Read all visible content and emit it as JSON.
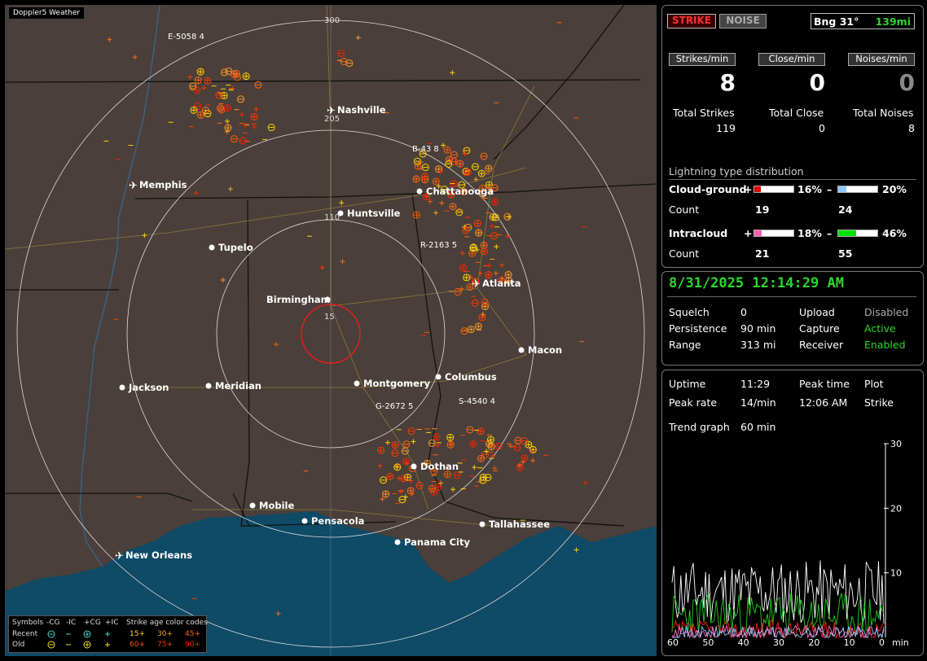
{
  "app_title": "Doppler5 Weather",
  "map": {
    "ring_labels": [
      "300",
      "205",
      "110",
      "15"
    ],
    "cities": [
      {
        "name": "Nashville",
        "kind": "airport"
      },
      {
        "name": "Memphis",
        "kind": "airport"
      },
      {
        "name": "Chattanooga",
        "kind": "city"
      },
      {
        "name": "Huntsville",
        "kind": "city"
      },
      {
        "name": "Tupelo",
        "kind": "city"
      },
      {
        "name": "Birmingham",
        "kind": "city"
      },
      {
        "name": "Atlanta",
        "kind": "airport"
      },
      {
        "name": "Macon",
        "kind": "city"
      },
      {
        "name": "Jackson",
        "kind": "city"
      },
      {
        "name": "Meridian",
        "kind": "city"
      },
      {
        "name": "Montgomery",
        "kind": "city"
      },
      {
        "name": "Columbus",
        "kind": "city"
      },
      {
        "name": "Dothan",
        "kind": "city"
      },
      {
        "name": "Mobile",
        "kind": "city"
      },
      {
        "name": "Pensacola",
        "kind": "city"
      },
      {
        "name": "Tallahassee",
        "kind": "city"
      },
      {
        "name": "Panama City",
        "kind": "city"
      },
      {
        "name": "New Orleans",
        "kind": "airport"
      }
    ],
    "storm_labels": [
      {
        "id": "E-5058",
        "n": "4"
      },
      {
        "id": "B-43",
        "n": "8"
      },
      {
        "id": "R-2163",
        "n": "5"
      },
      {
        "id": "G-2672",
        "n": "5"
      },
      {
        "id": "S-4540",
        "n": "4"
      }
    ]
  },
  "legend": {
    "symbols_label": "Symbols",
    "cols": [
      "-CG",
      "-IC",
      "+CG",
      "+IC"
    ],
    "recent": "Recent",
    "old": "Old",
    "age_title": "Strike age color codes",
    "ages_recent": [
      "15+",
      "30+",
      "45+"
    ],
    "ages_old": [
      "60+",
      "75+",
      "90+"
    ],
    "age_colors": [
      "#ffd400",
      "#ff9c20",
      "#ff6a1a",
      "#ff5a00",
      "#ff3a00",
      "#ff2000"
    ]
  },
  "status": {
    "strike_btn": "STRIKE",
    "noise_btn": "NOISE",
    "bearing": "Bng 31°",
    "distance": "139mi",
    "strikes_min_label": "Strikes/min",
    "close_min_label": "Close/min",
    "noises_min_label": "Noises/min",
    "strikes_min": "8",
    "close_min": "0",
    "noises_min": "0",
    "total_strikes_label": "Total Strikes",
    "total_close_label": "Total Close",
    "total_noises_label": "Total Noises",
    "total_strikes": "119",
    "total_close": "0",
    "total_noises": "8",
    "dist_title": "Lightning type distribution",
    "cg_label": "Cloud-ground",
    "ic_label": "Intracloud",
    "count_label": "Count",
    "plus": "+",
    "minus": "–",
    "cg_plus_pct": "16%",
    "cg_minus_pct": "20%",
    "ic_plus_pct": "18%",
    "ic_minus_pct": "46%",
    "cg_plus_count": "19",
    "cg_minus_count": "24",
    "ic_plus_count": "21",
    "ic_minus_count": "55",
    "cg_plus_color": "#e00000",
    "cg_minus_color": "#8ec8ff",
    "ic_plus_color": "#ff5fb0",
    "ic_minus_color": "#00e000"
  },
  "settings": {
    "datetime": "8/31/2025 12:14:29 AM",
    "squelch_label": "Squelch",
    "squelch": "0",
    "persistence_label": "Persistence",
    "persistence": "90 min",
    "range_label": "Range",
    "range": "313 mi",
    "upload_label": "Upload",
    "upload": "Disabled",
    "capture_label": "Capture",
    "capture": "Active",
    "receiver_label": "Receiver",
    "receiver": "Enabled"
  },
  "stats": {
    "uptime_label": "Uptime",
    "uptime": "11:29",
    "peak_time_label": "Peak time",
    "plot_label": "Plot",
    "peak_rate_label": "Peak rate",
    "peak_rate": "14/min",
    "peak_time": "12:06 AM",
    "plot": "Strike",
    "trend_label": "Trend graph",
    "trend_window": "60 min"
  },
  "chart_data": {
    "type": "line",
    "x_ticks": [
      "60",
      "50",
      "40",
      "30",
      "20",
      "10",
      "0"
    ],
    "x_unit": "min",
    "y_ticks": [
      "30",
      "20",
      "10"
    ],
    "ylim": [
      0,
      30
    ],
    "xlim": [
      60,
      0
    ]
  }
}
